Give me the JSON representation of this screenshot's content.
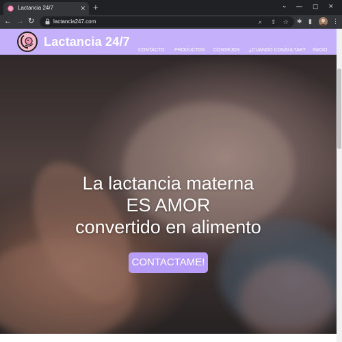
{
  "browser": {
    "tab_title": "Lactancia 24/7",
    "tab_close": "✕",
    "new_tab": "+",
    "url": "lactancia247.com",
    "icons": {
      "back": "←",
      "forward": "→",
      "reload": "↻",
      "zoom": "⌕",
      "share": "⇪",
      "star": "☆",
      "extensions": "✱",
      "side_panel": "▮",
      "menu": "⋮",
      "tab_search": "⌄",
      "minimize": "—",
      "maximize": "▢",
      "close": "✕"
    }
  },
  "site": {
    "brand": "Lactancia 24/7",
    "nav": [
      "CONTACTO",
      "PRODUCTOS",
      "CONSEJOS",
      "¿CUANDO CONSULTAR?",
      "INICIO"
    ],
    "hero": {
      "line1": "La lactancia materna",
      "line2": "ES AMOR",
      "line3": "convertido en alimento"
    },
    "cta_label": "CONTACTAME!"
  },
  "colors": {
    "header": "#c4b0fb",
    "cta": "#b79df7",
    "chrome_dark": "#202124",
    "chrome_toolbar": "#35363a"
  }
}
